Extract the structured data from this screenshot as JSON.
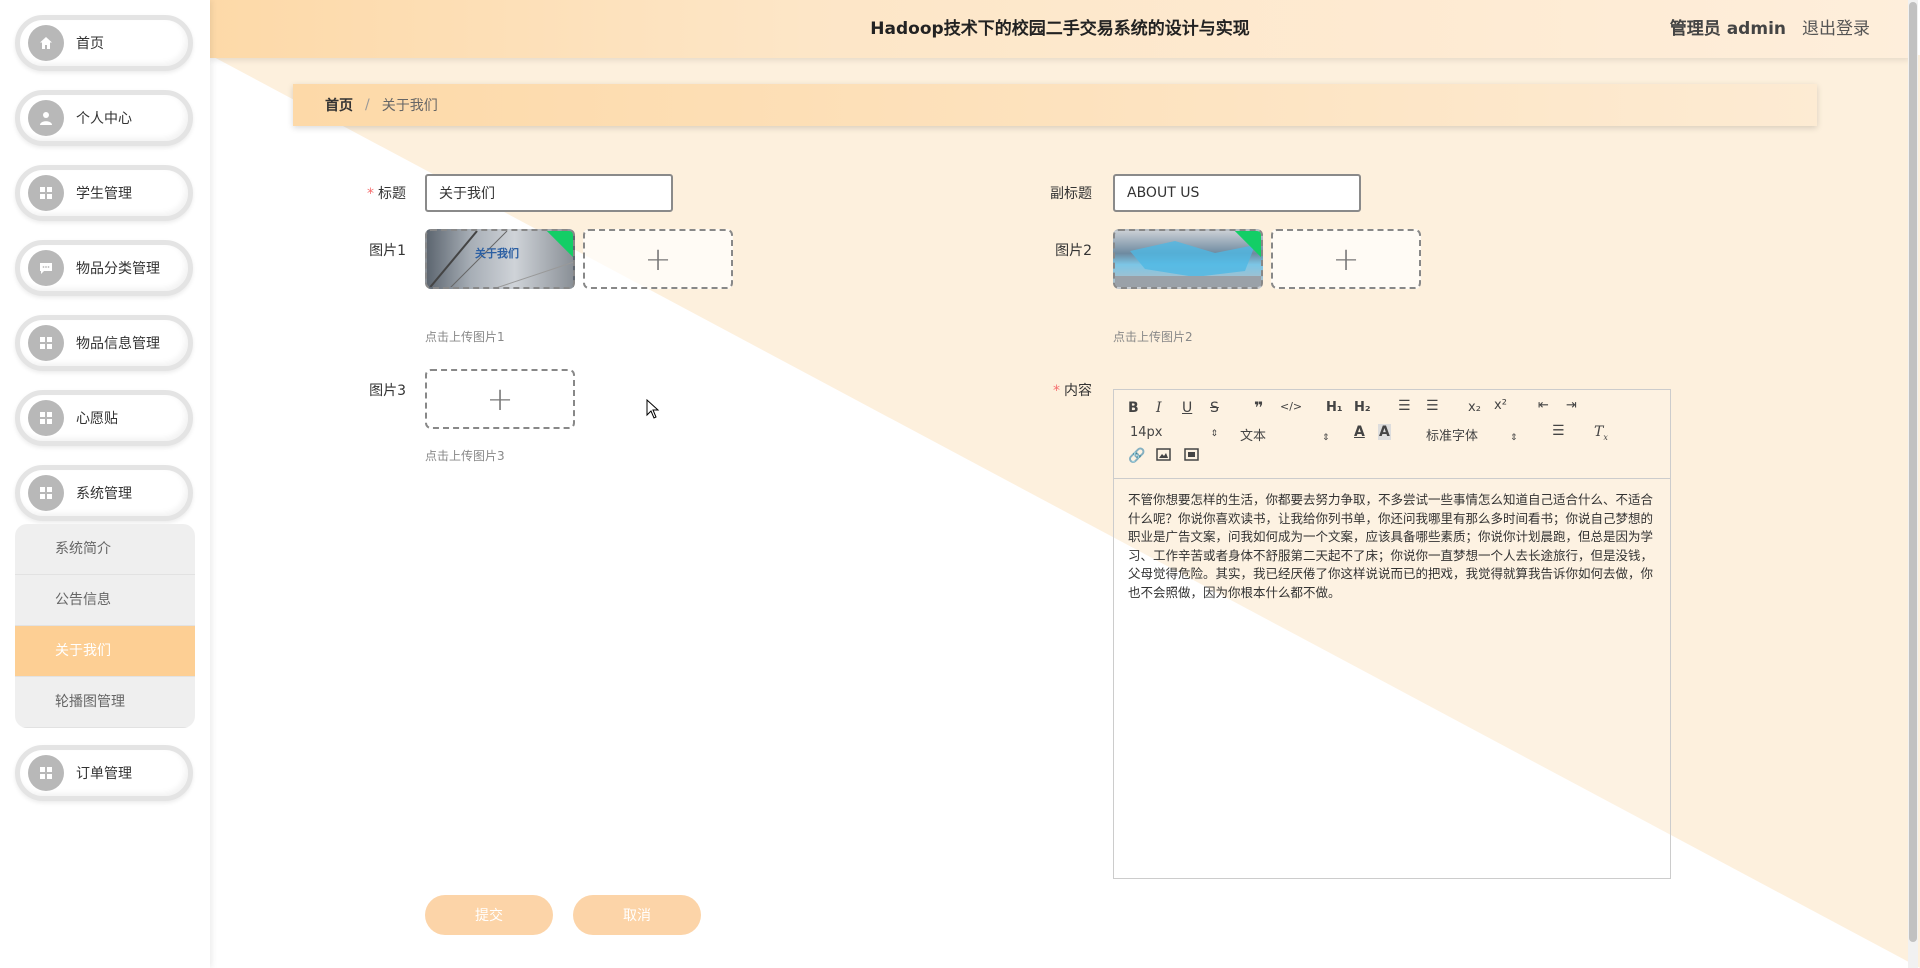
{
  "header": {
    "title": "Hadoop技术下的校园二手交易系统的设计与实现",
    "user": "管理员 admin",
    "logout": "退出登录"
  },
  "sidebar": {
    "items": [
      {
        "label": "首页",
        "icon": "home-icon"
      },
      {
        "label": "个人中心",
        "icon": "user-icon"
      },
      {
        "label": "学生管理",
        "icon": "grid-icon"
      },
      {
        "label": "物品分类管理",
        "icon": "chat-icon"
      },
      {
        "label": "物品信息管理",
        "icon": "grid-icon"
      },
      {
        "label": "心愿贴",
        "icon": "grid-icon"
      },
      {
        "label": "系统管理",
        "icon": "grid-icon"
      },
      {
        "label": "订单管理",
        "icon": "grid-icon"
      }
    ],
    "submenu": [
      "系统简介",
      "公告信息",
      "关于我们",
      "轮播图管理"
    ],
    "active_submenu": "关于我们"
  },
  "breadcrumb": {
    "home": "首页",
    "sep": "/",
    "current": "关于我们"
  },
  "form": {
    "title_label": "标题",
    "title_value": "关于我们",
    "subtitle_label": "副标题",
    "subtitle_value": "ABOUT US",
    "image1_label": "图片1",
    "image1_hint": "点击上传图片1",
    "image1_caption": "关于我们",
    "image2_label": "图片2",
    "image2_hint": "点击上传图片2",
    "image3_label": "图片3",
    "image3_hint": "点击上传图片3",
    "content_label": "内容",
    "upload_symbol": "+",
    "submit": "提交",
    "cancel": "取消"
  },
  "editor": {
    "font_size": "14px",
    "paragraph": "文本",
    "font_family": "标准字体",
    "content": "不管你想要怎样的生活，你都要去努力争取，不多尝试一些事情怎么知道自己适合什么、不适合什么呢？你说你喜欢读书，让我给你列书单，你还问我哪里有那么多时间看书；你说自己梦想的职业是广告文案，问我如何成为一个文案，应该具备哪些素质；你说你计划晨跑，但总是因为学习、工作辛苦或者身体不舒服第二天起不了床；你说你一直梦想一个人去长途旅行，但是没钱，父母觉得危险。其实，我已经厌倦了你这样说说而已的把戏，我觉得就算我告诉你如何去做，你也不会照做，因为你根本什么都不做。"
  },
  "colors": {
    "accent": "#fdcf94",
    "button": "#fcd4a8",
    "background_diagonal": "#fdf0dd",
    "required": "#f56c6c"
  }
}
